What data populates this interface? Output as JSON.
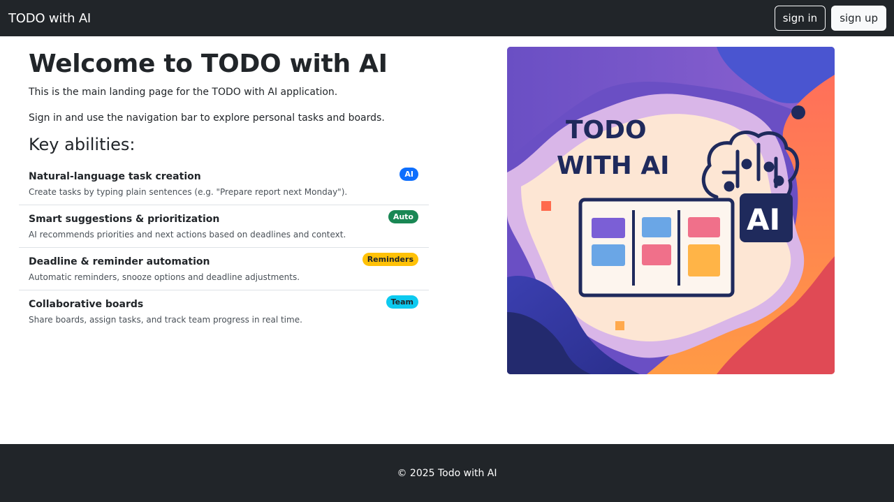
{
  "navbar": {
    "brand": "TODO with AI",
    "sign_in": "sign in",
    "sign_up": "sign up"
  },
  "main": {
    "title": "Welcome to TODO with AI",
    "intro": "This is the main landing page for the TODO with AI application.",
    "instructions": "Sign in and use the navigation bar to explore personal tasks and boards.",
    "abilities_heading": "Key abilities:",
    "abilities": [
      {
        "title": "Natural-language task creation",
        "description": "Create tasks by typing plain sentences (e.g. \"Prepare report next Monday\").",
        "badge": "AI",
        "badge_color": "#0d6efd",
        "badge_text_color": "#ffffff"
      },
      {
        "title": "Smart suggestions & prioritization",
        "description": "AI recommends priorities and next actions based on deadlines and context.",
        "badge": "Auto",
        "badge_color": "#198754",
        "badge_text_color": "#ffffff"
      },
      {
        "title": "Deadline & reminder automation",
        "description": "Automatic reminders, snooze options and deadline adjustments.",
        "badge": "Reminders",
        "badge_color": "#ffc107",
        "badge_text_color": "#212529"
      },
      {
        "title": "Collaborative boards",
        "description": "Share boards, assign tasks, and track team progress in real time.",
        "badge": "Team",
        "badge_color": "#0dcaf0",
        "badge_text_color": "#212529"
      }
    ]
  },
  "hero_image": {
    "line1": "TODO",
    "line2": "WITH AI",
    "chip_label": "AI"
  },
  "footer": {
    "copyright": "© 2025 Todo with AI"
  },
  "colors": {
    "dark": "#212529",
    "light": "#f8f9fa"
  }
}
